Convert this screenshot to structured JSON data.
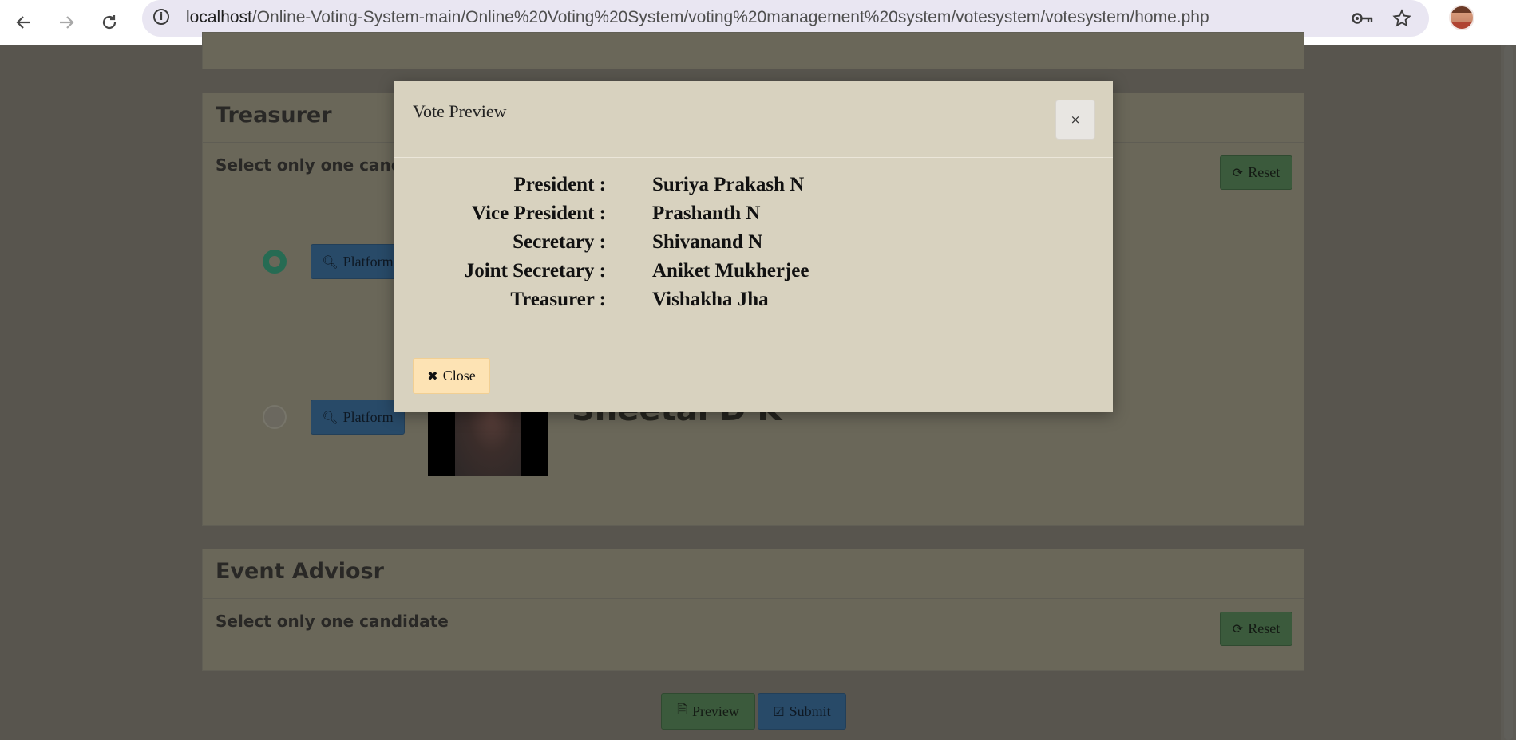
{
  "browser": {
    "url_host": "localhost",
    "url_path": "/Online-Voting-System-main/Online%20Voting%20System/voting%20management%20system/votesystem/votesystem/home.php"
  },
  "page": {
    "treasurer_section": {
      "title": "Treasurer",
      "hint": "Select only one candidate",
      "reset_label": "Reset",
      "platform_label": "Platform",
      "visible_candidate_name": "Sheetal D K"
    },
    "event_advisor_section": {
      "title": "Event Adviosr",
      "hint": "Select only one candidate",
      "reset_label": "Reset"
    },
    "preview_label": "Preview",
    "submit_label": "Submit"
  },
  "modal": {
    "title": "Vote Preview",
    "close_x": "×",
    "votes": [
      {
        "position": "President :",
        "candidate": "Suriya Prakash N"
      },
      {
        "position": "Vice President :",
        "candidate": "Prashanth N"
      },
      {
        "position": "Secretary :",
        "candidate": "Shivanand N"
      },
      {
        "position": "Joint Secretary :",
        "candidate": "Aniket Mukherjee"
      },
      {
        "position": "Treasurer :",
        "candidate": "Vishakha Jha"
      }
    ],
    "close_label": "Close"
  },
  "icons": {
    "back": "back-arrow-icon",
    "forward": "forward-arrow-icon",
    "reload": "reload-icon",
    "site_info": "info-icon",
    "password": "key-icon",
    "bookmark": "star-icon",
    "reset": "refresh-icon",
    "platform": "search-icon",
    "preview": "file-icon",
    "submit": "check-square-icon",
    "close": "times-icon"
  }
}
